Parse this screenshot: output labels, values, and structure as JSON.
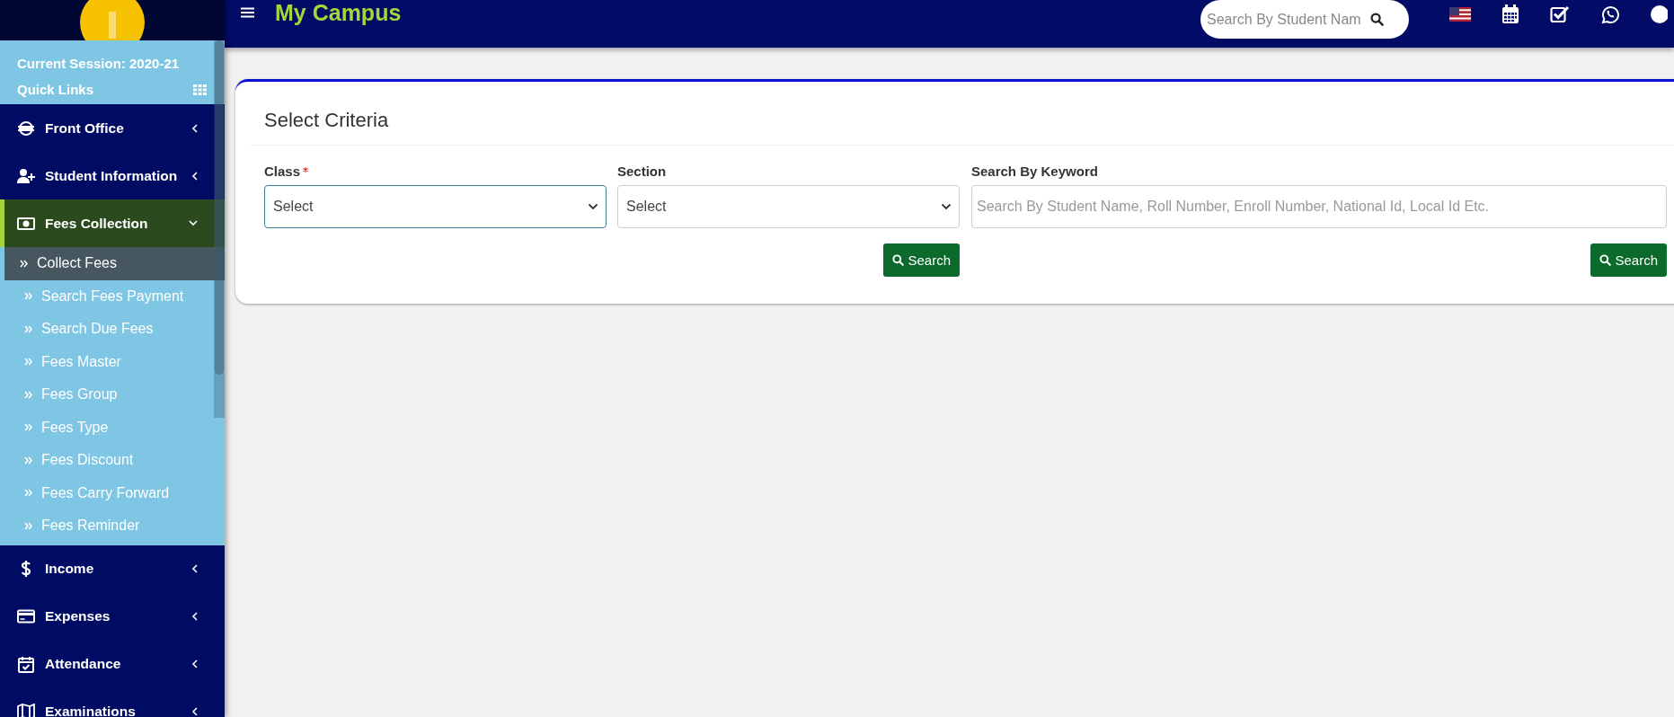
{
  "header": {
    "app_title": "My Campus",
    "search": {
      "placeholder": "Search By Student Nam"
    }
  },
  "sidebar": {
    "session": "Current Session: 2020-21",
    "quick_links": "Quick Links",
    "menu": [
      {
        "label": "Front Office",
        "expanded": false
      },
      {
        "label": "Student Information",
        "expanded": false
      },
      {
        "label": "Fees Collection",
        "expanded": true,
        "children": [
          {
            "label": "Collect Fees",
            "selected": true
          },
          {
            "label": "Search Fees Payment",
            "selected": false
          },
          {
            "label": "Search Due Fees",
            "selected": false
          },
          {
            "label": "Fees Master",
            "selected": false
          },
          {
            "label": "Fees Group",
            "selected": false
          },
          {
            "label": "Fees Type",
            "selected": false
          },
          {
            "label": "Fees Discount",
            "selected": false
          },
          {
            "label": "Fees Carry Forward",
            "selected": false
          },
          {
            "label": "Fees Reminder",
            "selected": false
          }
        ]
      },
      {
        "label": "Income",
        "expanded": false
      },
      {
        "label": "Expenses",
        "expanded": false
      },
      {
        "label": "Attendance",
        "expanded": false
      },
      {
        "label": "Examinations",
        "expanded": false
      }
    ]
  },
  "criteria": {
    "title": "Select Criteria",
    "groups": [
      {
        "fields": [
          {
            "kind": "select",
            "label": "Class",
            "required": true,
            "value": "Select"
          },
          {
            "kind": "select",
            "label": "Section",
            "required": false,
            "value": "Select"
          }
        ],
        "button": "Search"
      },
      {
        "fields": [
          {
            "kind": "text",
            "label": "Search By Keyword",
            "required": false,
            "placeholder": "Search By Student Name, Roll Number, Enroll Number, National Id, Local Id Etc."
          }
        ],
        "button": "Search"
      }
    ]
  }
}
